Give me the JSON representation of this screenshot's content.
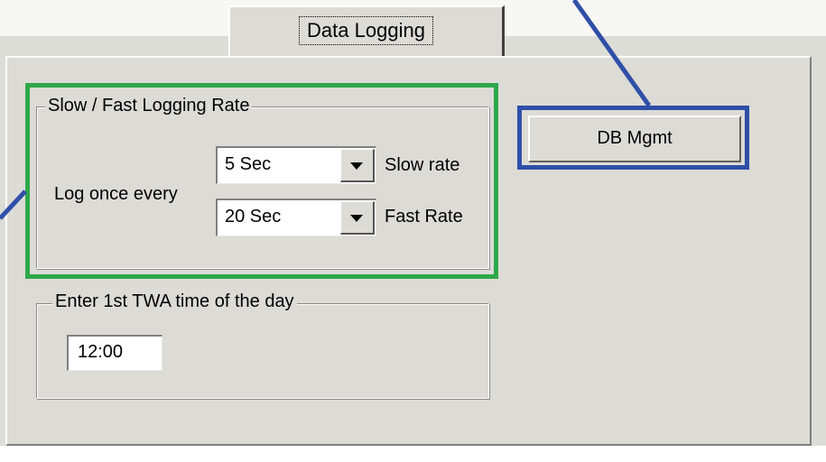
{
  "tabs": {
    "active_label": "Data Logging"
  },
  "logging_rate": {
    "title": "Slow / Fast Logging Rate",
    "log_once_every_label": "Log once every",
    "slow": {
      "value": "5 Sec",
      "label": "Slow rate"
    },
    "fast": {
      "value": "20 Sec",
      "label": "Fast Rate"
    }
  },
  "twa": {
    "title": "Enter 1st TWA time of the day",
    "time_value": "12:00"
  },
  "buttons": {
    "db_mgmt": "DB Mgmt"
  },
  "colors": {
    "green_highlight": "#2ea84a",
    "blue_highlight": "#2f4fa7",
    "dialog_bg": "#dcdbd6"
  }
}
